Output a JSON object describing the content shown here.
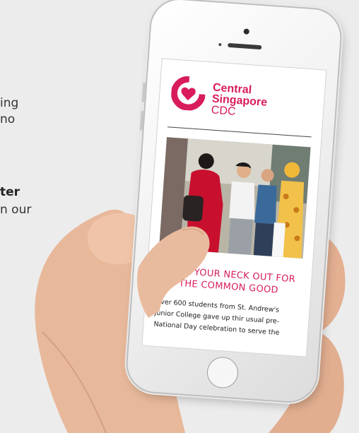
{
  "background": {
    "line1": "ing",
    "line2": "no",
    "line3": "ter",
    "line4": "n our"
  },
  "screen": {
    "logo": {
      "line1": "Central",
      "line2": "Singapore",
      "line3": "CDC",
      "brand_color": "#d81c5c"
    },
    "article": {
      "headline_line1": "STICK YOUR NECK OUT FOR",
      "headline_line2": "THE COMMON GOOD",
      "body_line1": "Over 600 students from St. Andrew's",
      "body_line2": "Junior College gave up thir usual pre-",
      "body_line3": "National Day celebration to serve the"
    }
  }
}
